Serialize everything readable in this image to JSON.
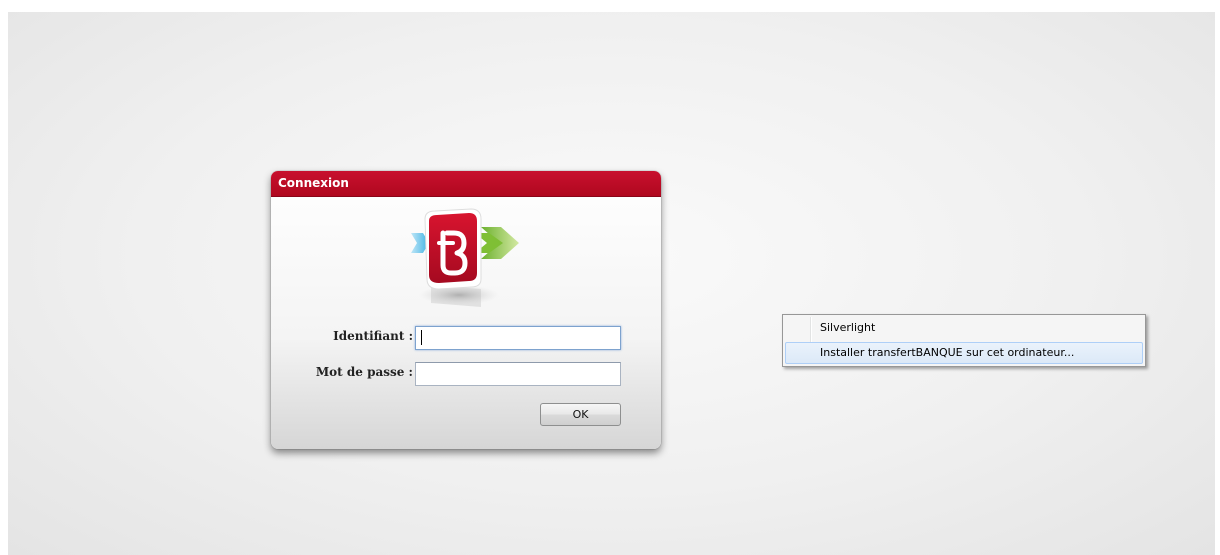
{
  "dialog": {
    "title": "Connexion",
    "fields": [
      {
        "label": "Identifiant :",
        "value": "",
        "focused": true
      },
      {
        "label": "Mot de passe :",
        "value": "",
        "focused": false
      }
    ],
    "ok_label": "OK",
    "colors": {
      "header": "#c8102e",
      "logo_red": "#c8102e",
      "arrow_green": "#8dc63f",
      "arrow_blue": "#5bc0eb"
    }
  },
  "context_menu": {
    "items": [
      {
        "label": "Silverlight",
        "highlighted": false
      },
      {
        "label": "Installer transfertBANQUE sur cet ordinateur...",
        "highlighted": true
      }
    ]
  }
}
